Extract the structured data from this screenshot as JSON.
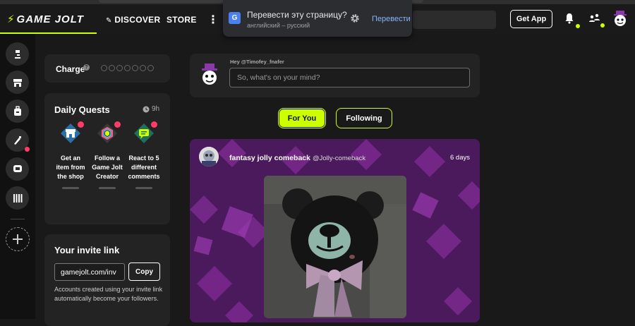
{
  "header": {
    "logo_text": "GAME JOLT",
    "nav": {
      "discover": "DISCOVER",
      "store": "STORE",
      "more": "⋮"
    },
    "get_app": "Get App"
  },
  "translate_popup": {
    "title": "Перевести эту страницу?",
    "languages": "английский – русский",
    "translate_button": "Перевести"
  },
  "charge": {
    "label": "Charge",
    "orb_count": 7
  },
  "daily_quests": {
    "title": "Daily Quests",
    "time_left": "9h",
    "quests": [
      {
        "label": "Get an item from the shop",
        "icon": "shop-icon"
      },
      {
        "label": "Follow a Game Jolt Creator",
        "icon": "creator-icon"
      },
      {
        "label": "React to 5 different comments",
        "icon": "comment-icon"
      }
    ]
  },
  "invite": {
    "title": "Your invite link",
    "link_value": "gamejolt.com/inv",
    "copy_label": "Copy",
    "description": "Accounts created using your invite link automatically become your followers."
  },
  "composer": {
    "greeting": "Hey @Timofey_fnafer",
    "placeholder": "So, what's on your mind?"
  },
  "feed_tabs": {
    "for_you": "For You",
    "following": "Following"
  },
  "post": {
    "author": "fantasy jolly comeback",
    "handle": "@Jolly-comeback",
    "time": "6 days"
  },
  "colors": {
    "accent": "#ccff00",
    "notification": "#ff3d67",
    "post_bg": "#4a1a5c"
  }
}
